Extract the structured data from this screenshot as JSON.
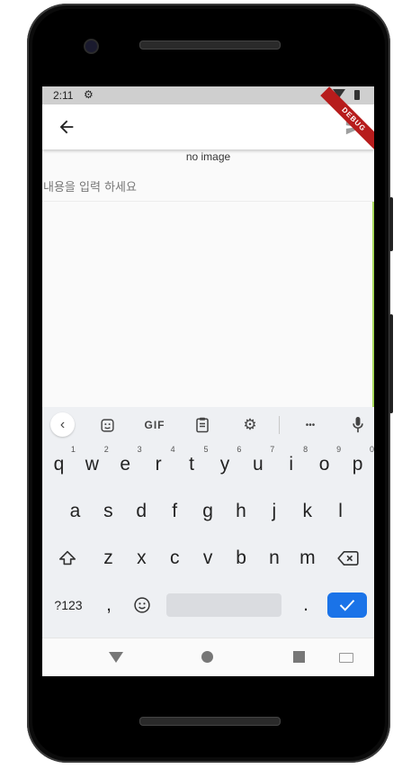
{
  "status_bar": {
    "time": "2:11",
    "settings_icon": "gear-icon",
    "wifi_icon": "wifi-icon",
    "battery_icon": "battery-icon"
  },
  "app_bar": {
    "back_icon": "arrow-back-icon",
    "send_icon": "send-icon",
    "debug_banner": "DEBUG"
  },
  "post": {
    "image_placeholder": "no image",
    "content_placeholder": "내용을 입력 하세요",
    "content_value": ""
  },
  "keyboard": {
    "toolbar": {
      "gif_label": "GIF",
      "more_label": "•••"
    },
    "row1": [
      {
        "k": "q",
        "n": "1"
      },
      {
        "k": "w",
        "n": "2"
      },
      {
        "k": "e",
        "n": "3"
      },
      {
        "k": "r",
        "n": "4"
      },
      {
        "k": "t",
        "n": "5"
      },
      {
        "k": "y",
        "n": "6"
      },
      {
        "k": "u",
        "n": "7"
      },
      {
        "k": "i",
        "n": "8"
      },
      {
        "k": "o",
        "n": "9"
      },
      {
        "k": "p",
        "n": "0"
      }
    ],
    "row2": [
      "a",
      "s",
      "d",
      "f",
      "g",
      "h",
      "j",
      "k",
      "l"
    ],
    "row3": [
      "z",
      "x",
      "c",
      "v",
      "b",
      "n",
      "m"
    ],
    "bottom": {
      "symbols": "?123",
      "comma": ",",
      "period": "."
    }
  },
  "colors": {
    "enter_key": "#1a73e8",
    "debug_banner": "#b71c1c",
    "edge_highlight": "#a8d85a"
  }
}
